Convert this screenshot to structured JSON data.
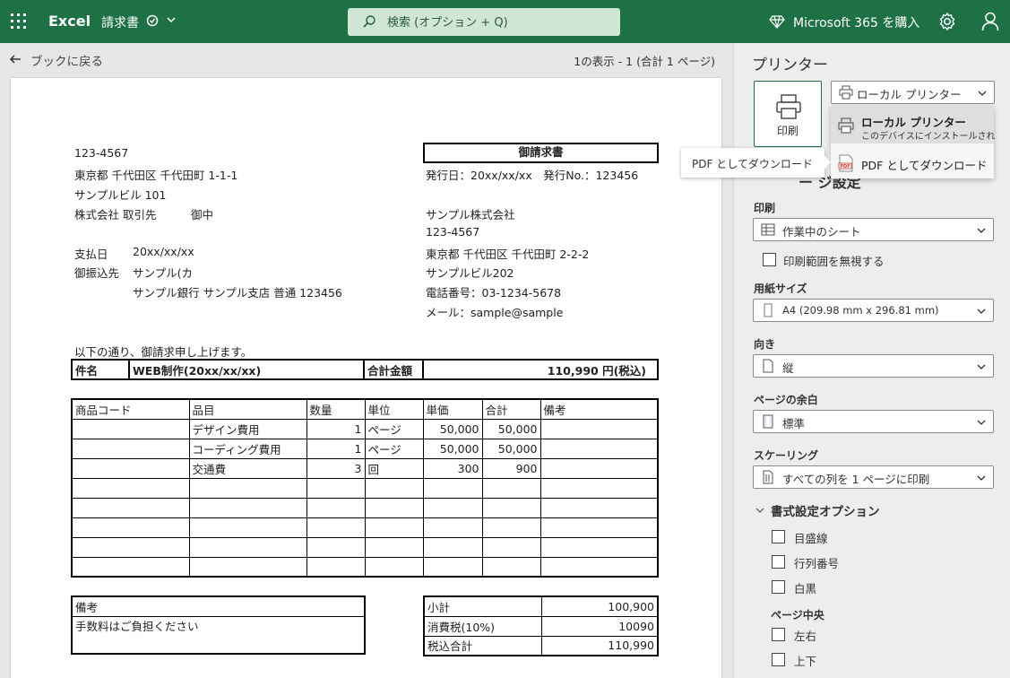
{
  "app": {
    "name": "Excel",
    "doc_name": "請求書",
    "search_placeholder": "検索 (オプション + Q)",
    "m365_label": "Microsoft 365 を購入"
  },
  "preview": {
    "back_label": "ブックに戻る",
    "page_info": "1の表示 - 1 (合計 1 ページ)"
  },
  "invoice": {
    "to": {
      "postal": "123-4567",
      "address": "東京都 千代田区 千代田町 1-1-1",
      "building": "サンプルビル 101",
      "company": "株式会社 取引先",
      "honorific": "御中"
    },
    "payment": {
      "due_label": "支払日",
      "due_value": "20xx/xx/xx",
      "account_label": "御振込先",
      "account_name": "サンプル(カ",
      "bank": "サンプル銀行 サンプル支店 普通 123456"
    },
    "title": "御請求書",
    "issue_line": "発行日：20xx/xx/xx　発行No.：123456",
    "from": {
      "company": "サンプル株式会社",
      "postal": "123-4567",
      "address": "東京都 千代田区 千代田町 2-2-2",
      "building": "サンプルビル202",
      "phone": "電話番号：03-1234-5678",
      "email": "メール：sample@sample"
    },
    "intro": "以下の通り、御請求申し上げます。",
    "summary": {
      "subject_label": "件名",
      "subject_value": "WEB制作(20xx/xx/xx)",
      "total_label": "合計金額",
      "total_value": "110,990 円(税込)"
    },
    "items_header": [
      "商品コード",
      "品目",
      "数量",
      "単位",
      "単価",
      "合計",
      "備考"
    ],
    "items": [
      [
        "",
        "デザイン費用",
        "1",
        "ページ",
        "50,000",
        "50,000",
        ""
      ],
      [
        "",
        "コーディング費用",
        "1",
        "ページ",
        "50,000",
        "50,000",
        ""
      ],
      [
        "",
        "交通費",
        "3",
        "回",
        "300",
        "900",
        ""
      ],
      [
        "",
        "",
        "",
        "",
        "",
        "",
        ""
      ],
      [
        "",
        "",
        "",
        "",
        "",
        "",
        ""
      ],
      [
        "",
        "",
        "",
        "",
        "",
        "",
        ""
      ],
      [
        "",
        "",
        "",
        "",
        "",
        "",
        ""
      ],
      [
        "",
        "",
        "",
        "",
        "",
        "",
        ""
      ]
    ],
    "notes_label": "備考",
    "notes_value": "手数料はご負担ください",
    "totals": [
      [
        "小計",
        "100,900"
      ],
      [
        "消費税(10%)",
        "10090"
      ],
      [
        "税込合計",
        "110,990"
      ]
    ]
  },
  "panel": {
    "printer_title": "プリンター",
    "print_button": "印刷",
    "printer_select": "ローカル プリンター",
    "menu": {
      "local_title": "ローカル プリンター",
      "local_sub": "このデバイスにインストールされ",
      "pdf": "PDF としてダウンロード"
    },
    "tooltip": "PDF としてダウンロード",
    "page_settings_partial": "ページ設定",
    "print_label": "印刷",
    "print_value": "作業中のシート",
    "ignore_area": "印刷範囲を無視する",
    "paper_label": "用紙サイズ",
    "paper_value": "A4 (209.98 mm x 296.81 mm)",
    "orientation_label": "向き",
    "orientation_value": "縦",
    "margins_label": "ページの余白",
    "margins_value": "標準",
    "scaling_label": "スケーリング",
    "scaling_value": "すべての列を 1 ページに印刷",
    "format_options_title": "書式設定オプション",
    "gridlines": "目盛線",
    "headings": "行列番号",
    "bw": "白黒",
    "center_title": "ページ中央",
    "center_h": "左右",
    "center_v": "上下"
  },
  "colors": {
    "brand": "#1e7145",
    "search_bg": "#cfe5d6",
    "panel_bg": "#ededed"
  }
}
